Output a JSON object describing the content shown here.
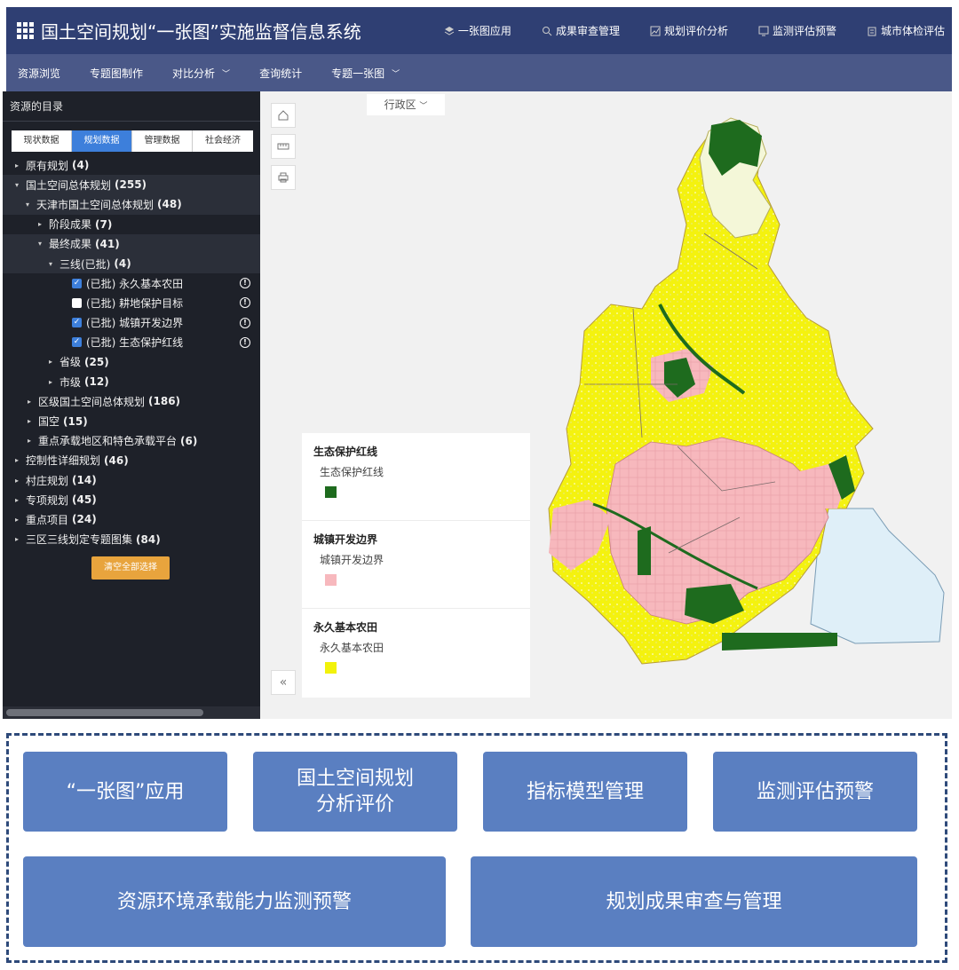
{
  "header": {
    "title": "国土空间规划“一张图”实施监督信息系统",
    "nav": [
      {
        "label": "一张图应用",
        "icon": "layers-icon"
      },
      {
        "label": "成果审查管理",
        "icon": "search-icon"
      },
      {
        "label": "规划评价分析",
        "icon": "chart-icon"
      },
      {
        "label": "监测评估预警",
        "icon": "monitor-icon"
      },
      {
        "label": "城市体检评估",
        "icon": "clipboard-icon"
      }
    ]
  },
  "subnav": [
    {
      "label": "资源浏览"
    },
    {
      "label": "专题图制作"
    },
    {
      "label": "对比分析"
    },
    {
      "label": "查询统计"
    },
    {
      "label": "专题一张图"
    }
  ],
  "sidebar": {
    "title": "资源的目录",
    "tabs": [
      "现状数据",
      "规划数据",
      "管理数据",
      "社会经济"
    ],
    "active_tab": "规划数据",
    "tree": [
      {
        "label": "原有规划",
        "count": "(4)"
      },
      {
        "label": "国土空间总体规划",
        "count": "(255)"
      },
      {
        "label": "天津市国土空间总体规划",
        "count": "(48)"
      },
      {
        "label": "阶段成果",
        "count": "(7)"
      },
      {
        "label": "最终成果",
        "count": "(41)"
      },
      {
        "label": "三线(已批)",
        "count": "(4)"
      },
      {
        "label": "(已批) 永久基本农田",
        "count": ""
      },
      {
        "label": "(已批) 耕地保护目标",
        "count": ""
      },
      {
        "label": "(已批) 城镇开发边界",
        "count": ""
      },
      {
        "label": "(已批) 生态保护红线",
        "count": ""
      },
      {
        "label": "省级",
        "count": "(25)"
      },
      {
        "label": "市级",
        "count": "(12)"
      },
      {
        "label": "区级国土空间总体规划",
        "count": "(186)"
      },
      {
        "label": "国空",
        "count": "(15)"
      },
      {
        "label": "重点承载地区和特色承载平台",
        "count": "(6)"
      },
      {
        "label": "控制性详细规划",
        "count": "(46)"
      },
      {
        "label": "村庄规划",
        "count": "(14)"
      },
      {
        "label": "专项规划",
        "count": "(45)"
      },
      {
        "label": "重点项目",
        "count": "(24)"
      },
      {
        "label": "三区三线划定专题图集",
        "count": "(84)"
      }
    ],
    "checkbox_states": {
      "永久基本农田": true,
      "耕地保护目标": false,
      "城镇开发边界": true,
      "生态保护红线": true
    },
    "clear_button": "清空全部选择"
  },
  "map": {
    "region_select": "行政区",
    "legend": [
      {
        "heading": "生态保护红线",
        "item": "生态保护红线",
        "color": "#1e6b1e"
      },
      {
        "heading": "城镇开发边界",
        "item": "城镇开发边界",
        "color": "#f7b8bd"
      },
      {
        "heading": "永久基本农田",
        "item": "永久基本农田",
        "color": "#f2f20a"
      }
    ]
  },
  "features": {
    "row1": [
      "“一张图”应用",
      "国土空间规划\n分析评价",
      "指标模型管理",
      "监测评估预警"
    ],
    "row2": [
      "资源环境承载能力监测预警",
      "规划成果审查与管理"
    ]
  },
  "colors": {
    "header_bg": "#2f3f73",
    "subnav_bg": "#4a5888",
    "panel_bg": "#1e2129",
    "accent": "#3d7fdb",
    "feature_box": "#5a7fc1",
    "button_orange": "#e8a43d"
  }
}
